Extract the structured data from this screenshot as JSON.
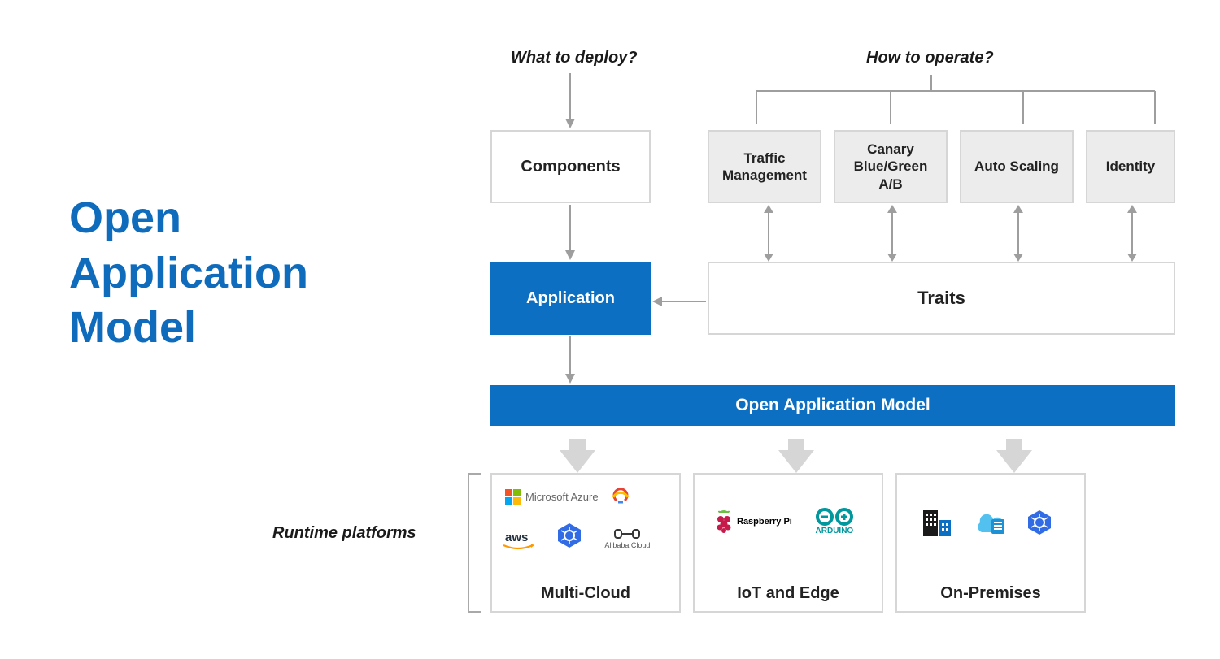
{
  "title": {
    "line1": "Open",
    "line2": "Application",
    "line3": "Model"
  },
  "questions": {
    "deploy": "What to deploy?",
    "operate": "How to operate?"
  },
  "labels": {
    "runtime": "Runtime platforms"
  },
  "boxes": {
    "components": "Components",
    "application": "Application",
    "traits": "Traits",
    "oam_bar": "Open Application Model"
  },
  "trait_examples": {
    "t1": "Traffic Management",
    "t2": "Canary Blue/Green A/B",
    "t3": "Auto Scaling",
    "t4": "Identity"
  },
  "platforms": {
    "p1": {
      "title": "Multi-Cloud",
      "logos": [
        "Microsoft Azure",
        "Google Cloud",
        "aws",
        "Kubernetes",
        "Alibaba Cloud"
      ]
    },
    "p2": {
      "title": "IoT and Edge",
      "logos": [
        "Raspberry Pi",
        "ARDUINO"
      ]
    },
    "p3": {
      "title": "On-Premises"
    }
  },
  "colors": {
    "brand_blue": "#0d6fc1",
    "title_blue": "#0f6cbd",
    "grey": "#d6d6d6"
  }
}
